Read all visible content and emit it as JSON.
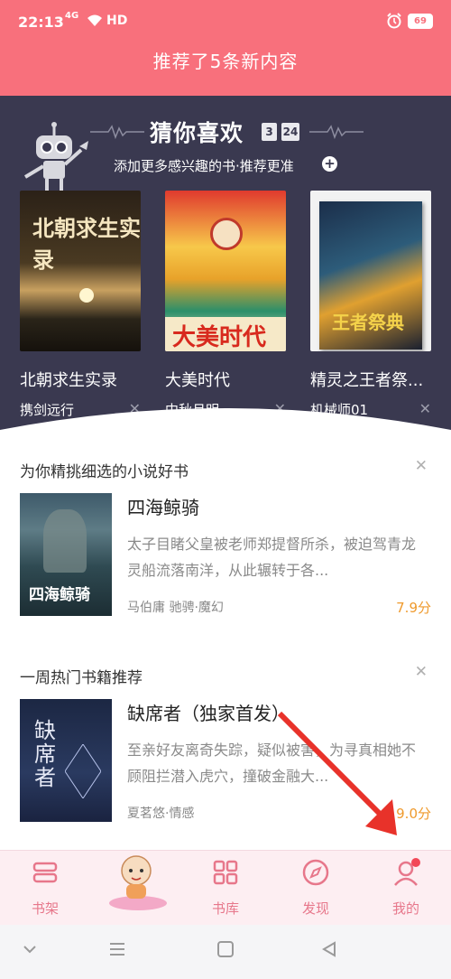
{
  "status_bar": {
    "time": "22:13",
    "network": "4G",
    "hd": "HD",
    "battery": "69"
  },
  "notice": {
    "text": "推荐了5条新内容"
  },
  "recommend": {
    "title": "猜你喜欢",
    "date_month": "3",
    "date_day": "24",
    "subtitle": "添加更多感兴趣的书·推荐更准",
    "books": [
      {
        "title": "北朝求生实录",
        "author": "携剑远行",
        "cover_text": "北朝求生实录"
      },
      {
        "title": "大美时代",
        "author": "中秋月明",
        "cover_text": "大美时代"
      },
      {
        "title": "精灵之王者祭...",
        "author": "机械师01",
        "cover_text": "王者祭典"
      }
    ]
  },
  "sections": [
    {
      "header": "为你精挑细选的小说好书",
      "book": {
        "title": "四海鲸骑",
        "desc": "太子目睹父皇被老师郑提督所杀，被迫驾青龙灵船流落南洋，从此辗转于各...",
        "meta": "马伯庸 驰骋·魔幻",
        "score": "7.9分",
        "cover_text": "四海鲸骑"
      }
    },
    {
      "header": "一周热门书籍推荐",
      "book": {
        "title": "缺席者（独家首发）",
        "desc": "至亲好友离奇失踪，疑似被害，为寻真相她不顾阻拦潜入虎穴，撞破金融大...",
        "meta": "夏茗悠·情感",
        "score": "9.0分",
        "cover_text": "缺席者"
      }
    }
  ],
  "bottom_nav": [
    {
      "label": "书架",
      "icon": "bookshelf-icon"
    },
    {
      "label": "",
      "icon": "mascot-icon"
    },
    {
      "label": "书库",
      "icon": "library-grid-icon"
    },
    {
      "label": "发现",
      "icon": "compass-icon"
    },
    {
      "label": "我的",
      "icon": "profile-icon"
    }
  ],
  "colors": {
    "brand_pink": "#f8707c",
    "panel_dark": "#3a3950",
    "score_orange": "#ef9a2d",
    "nav_label": "#e7778b",
    "arrow_red": "#e8322a"
  }
}
